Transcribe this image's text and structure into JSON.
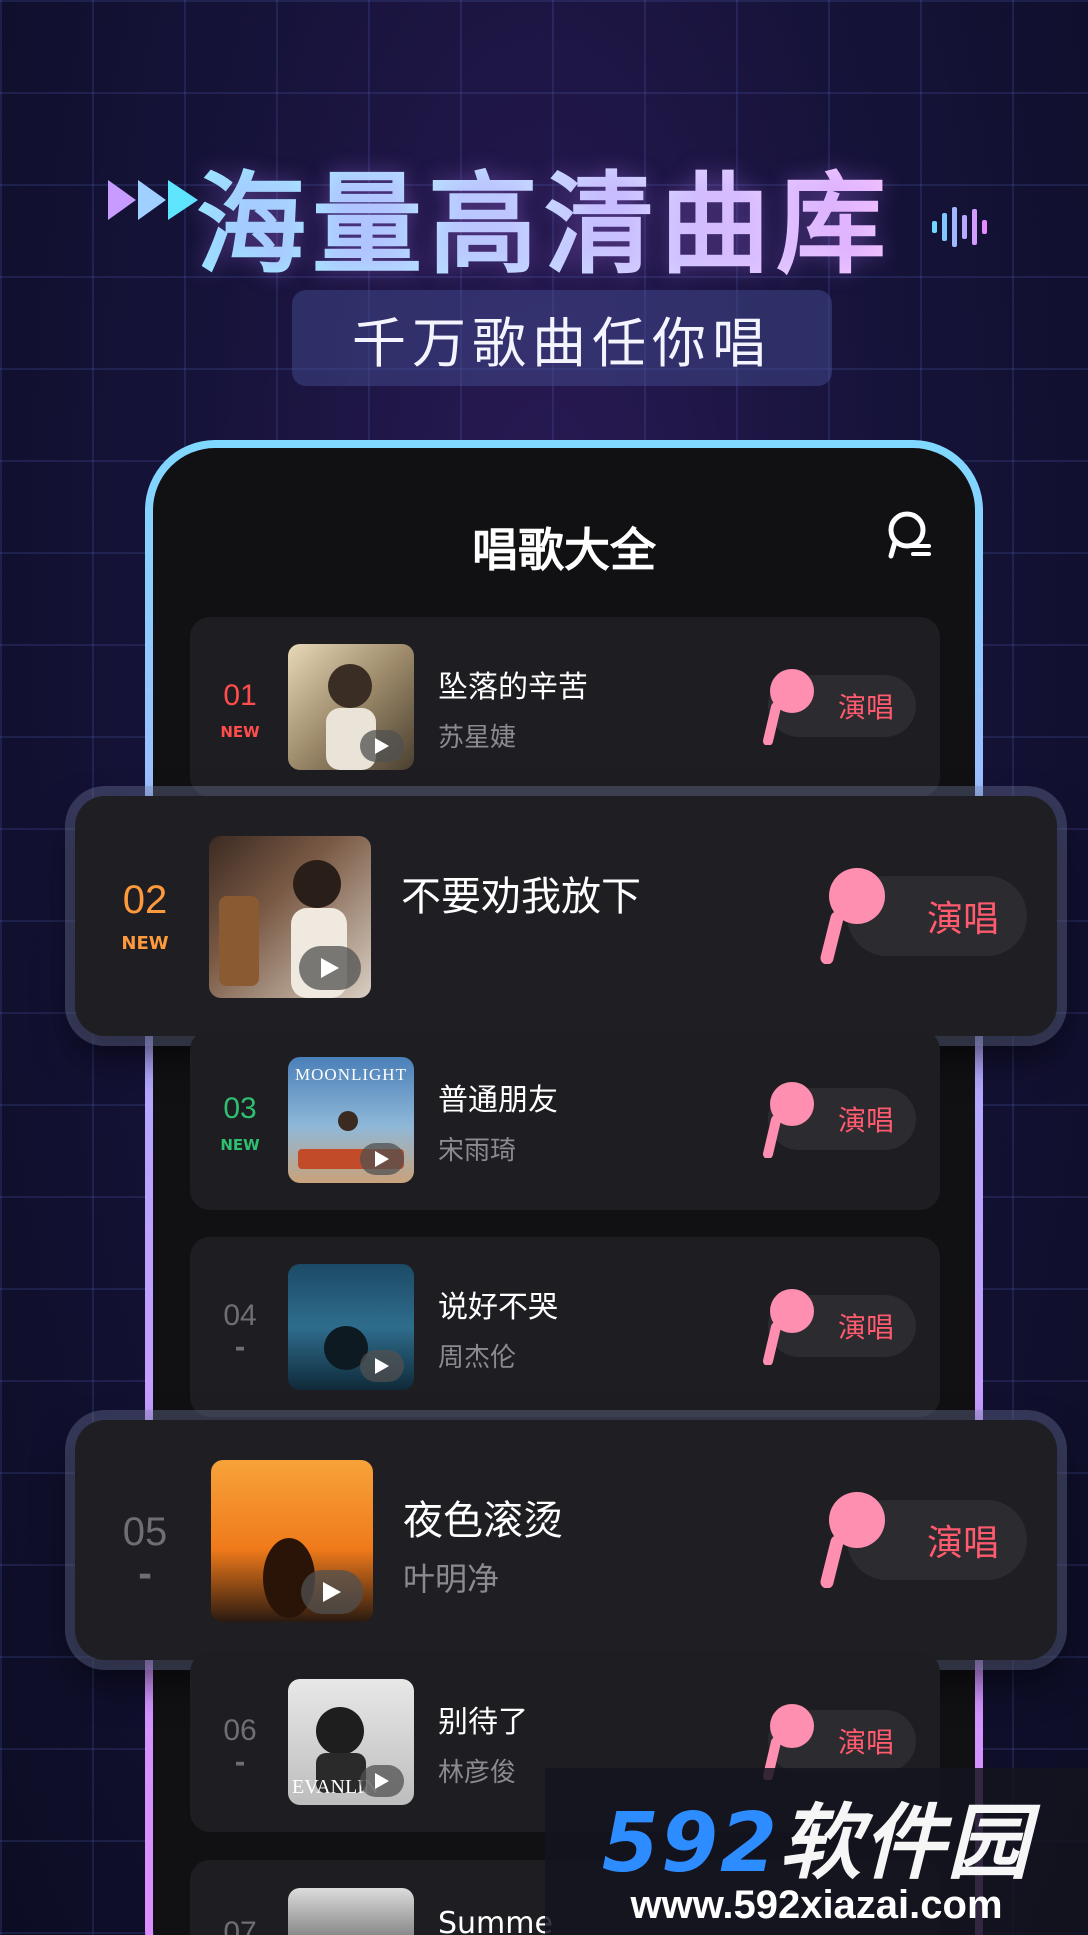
{
  "hero": {
    "title": "海量高清曲库",
    "subtitle": "千万歌曲任你唱"
  },
  "app": {
    "title": "唱歌大全",
    "top_icon": "karaoke-mic-icon"
  },
  "colors": {
    "accent_red": "#ff5a6e",
    "new_1": "#ff4d4d",
    "new_2": "#ff9a3c",
    "new_3": "#2fbf71",
    "rank_gray": "#6e6e74",
    "mic_pink": "#ff8fb0"
  },
  "songs": [
    {
      "rank": "01",
      "tag": "NEW",
      "title": "坠落的辛苦",
      "artist": "苏星婕",
      "action": "演唱"
    },
    {
      "rank": "02",
      "tag": "NEW",
      "title": "不要劝我放下",
      "artist": "",
      "action": "演唱"
    },
    {
      "rank": "03",
      "tag": "NEW",
      "title": "普通朋友",
      "artist": "宋雨琦",
      "action": "演唱",
      "cover_text": "MOONLIGHT"
    },
    {
      "rank": "04",
      "tag": "-",
      "title": "说好不哭",
      "artist": "周杰伦",
      "action": "演唱"
    },
    {
      "rank": "05",
      "tag": "-",
      "title": "夜色滚烫",
      "artist": "叶明净",
      "action": "演唱"
    },
    {
      "rank": "06",
      "tag": "-",
      "title": "别待了",
      "artist": "林彦俊",
      "action": "演唱",
      "cover_text": "EVANLIN"
    },
    {
      "rank": "07",
      "tag": "",
      "title": "Summe",
      "artist": "",
      "action": ""
    }
  ],
  "watermark": {
    "logo_num": "592",
    "logo_text": "软件园",
    "url": "www.592xiazai.com"
  }
}
